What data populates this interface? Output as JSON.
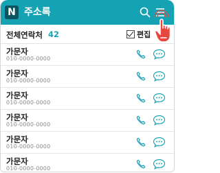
{
  "app": {
    "logo_letter": "N",
    "title": "주소록"
  },
  "header_icons": [
    "search-icon",
    "menu-icon"
  ],
  "summary": {
    "total_label": "전체연락처",
    "total_count": "42",
    "edit_label": "편집"
  },
  "contacts": [
    {
      "name": "가문자",
      "phone": "010-0000-0000"
    },
    {
      "name": "가문자",
      "phone": "010-0000-0000"
    },
    {
      "name": "가문자",
      "phone": "010-0000-0000"
    },
    {
      "name": "가문자",
      "phone": "010-0000-0000"
    },
    {
      "name": "가문자",
      "phone": "010-0000-0000"
    },
    {
      "name": "가문자",
      "phone": "010-0000-0000"
    }
  ],
  "colors": {
    "accent": "#15a3b4",
    "logo_bg": "#0a5560",
    "touch_hand": "#e8473d"
  }
}
